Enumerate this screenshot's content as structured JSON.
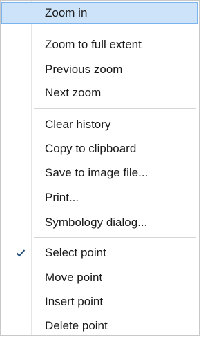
{
  "menu": {
    "items": [
      {
        "label": "Zoom in"
      },
      {
        "label": "Zoom to full extent"
      },
      {
        "label": "Previous zoom"
      },
      {
        "label": "Next zoom"
      },
      {
        "label": "Clear history"
      },
      {
        "label": "Copy to clipboard"
      },
      {
        "label": "Save to image file..."
      },
      {
        "label": "Print..."
      },
      {
        "label": "Symbology dialog..."
      },
      {
        "label": "Select point"
      },
      {
        "label": "Move point"
      },
      {
        "label": "Insert point"
      },
      {
        "label": "Delete point"
      }
    ],
    "highlighted_item": "Zoom in",
    "checked_item": "Select point",
    "check_icon": "checkmark-icon",
    "colors": {
      "highlight_fill": "#cde3f9",
      "highlight_border": "#7ab4ee",
      "separator": "#d6d6d6",
      "checkmark": "#1f4e79"
    }
  }
}
